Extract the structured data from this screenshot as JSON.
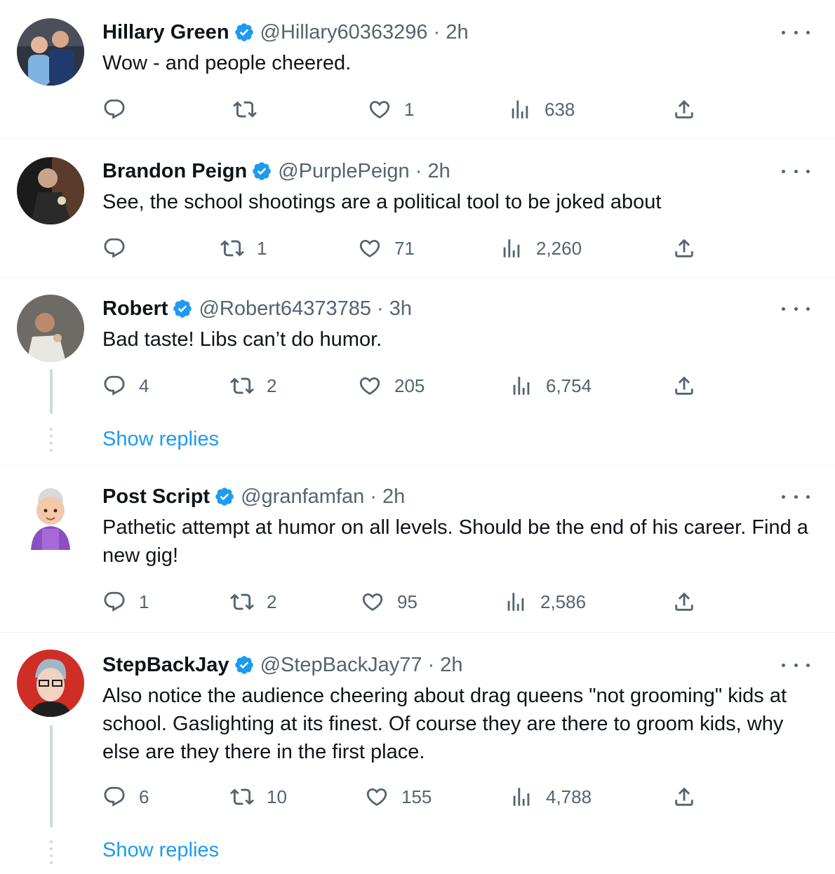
{
  "tweets": [
    {
      "name": "Hillary Green",
      "handle": "@Hillary60363296 · 2h",
      "text": "Wow - and people cheered.",
      "replies": "",
      "retweets": "",
      "likes": "1",
      "views": "638",
      "show_replies": ""
    },
    {
      "name": "Brandon Peign",
      "handle": "@PurplePeign · 2h",
      "text": "See, the school shootings are a political tool to be joked about",
      "replies": "",
      "retweets": "1",
      "likes": "71",
      "views": "2,260",
      "show_replies": ""
    },
    {
      "name": "Robert",
      "handle": "@Robert64373785 · 3h",
      "text": "Bad taste! Libs can’t do humor.",
      "replies": "4",
      "retweets": "2",
      "likes": "205",
      "views": "6,754",
      "show_replies": "Show replies"
    },
    {
      "name": "Post Script",
      "handle": "@granfamfan · 2h",
      "text": "Pathetic attempt at humor on all levels.  Should be the end of his career. Find a new gig!",
      "replies": "1",
      "retweets": "2",
      "likes": "95",
      "views": "2,586",
      "show_replies": ""
    },
    {
      "name": "StepBackJay",
      "handle": "@StepBackJay77 · 2h",
      "text": "Also notice the audience cheering about drag queens \"not grooming\" kids at school. Gaslighting at its finest. Of course they are there to groom kids, why else are they there in the first place.",
      "replies": "6",
      "retweets": "10",
      "likes": "155",
      "views": "4,788",
      "show_replies": "Show replies"
    }
  ],
  "icons": {
    "reply": "reply-icon",
    "retweet": "retweet-icon",
    "like": "heart-icon",
    "views": "views-icon",
    "share": "share-icon",
    "verified": "verified-badge-icon",
    "more": "more-icon"
  },
  "colors": {
    "accent": "#1d9bf0",
    "secondary_text": "#536471",
    "primary_text": "#0f1419",
    "divider": "#eff3f4"
  }
}
